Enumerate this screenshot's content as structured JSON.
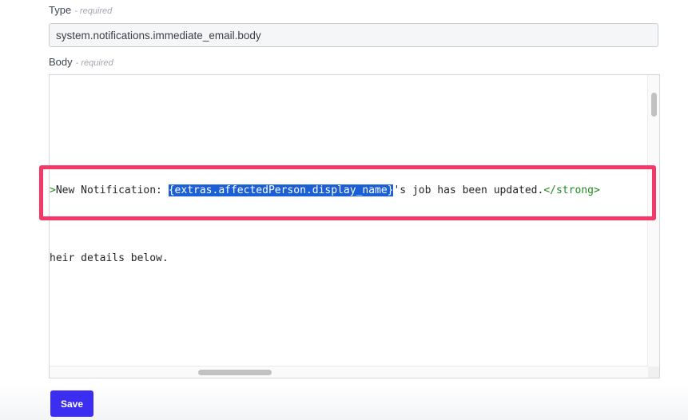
{
  "form": {
    "type_label": "Type",
    "type_required": "- required",
    "type_value": "system.notifications.immediate_email.body",
    "body_label": "Body",
    "body_required": "- required"
  },
  "editor": {
    "line1": {
      "tag_open_fragment": ">",
      "text_before": "New Notification: ",
      "selected_text": "{extras.affectedPerson.display_name}",
      "text_after": "'s job has been updated.",
      "tag_close": "</strong>"
    },
    "line2": "heir details below."
  },
  "actions": {
    "save_label": "Save"
  },
  "colors": {
    "accent": "#3b2ef0",
    "highlight": "#f43868",
    "selection": "#1a5fd6",
    "tag": "#1f8a1f"
  }
}
